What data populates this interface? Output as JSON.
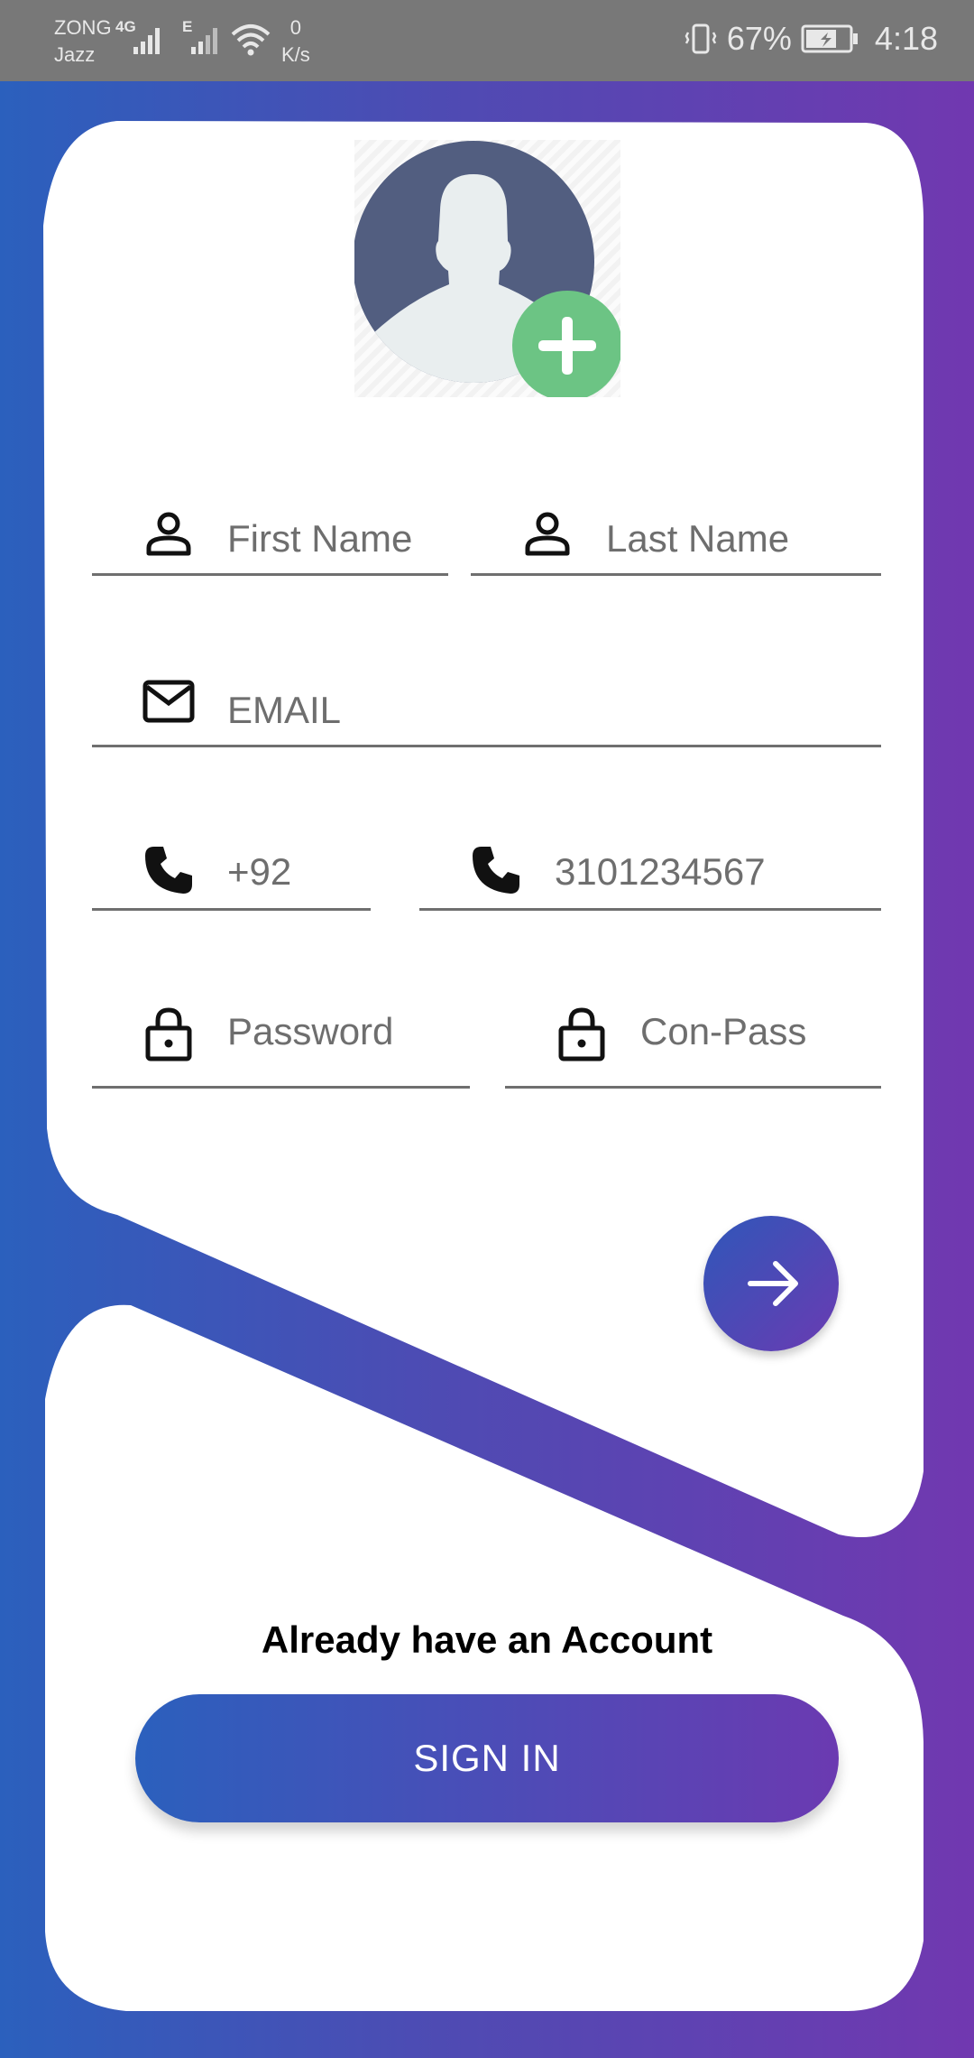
{
  "status_bar": {
    "carrier1": "ZONG",
    "carrier2": "Jazz",
    "net1": "4G",
    "net2": "E",
    "speed_value": "0",
    "speed_unit": "K/s",
    "battery": "67%",
    "time": "4:18"
  },
  "form": {
    "first_name_placeholder": "First Name",
    "last_name_placeholder": "Last Name",
    "email_placeholder": "EMAIL",
    "country_code_value": "+92",
    "phone_value": "3101234567",
    "password_placeholder": "Password",
    "confirm_password_placeholder": "Con-Pass"
  },
  "footer": {
    "already_text": "Already have an Account",
    "signin_label": "SIGN IN"
  },
  "colors": {
    "gradient_start": "#2b60bd",
    "gradient_end": "#7138b0",
    "add_photo_green": "#6cc484"
  },
  "icons": [
    "person-icon",
    "email-icon",
    "phone-icon",
    "lock-icon",
    "arrow-right-icon",
    "plus-icon",
    "avatar-placeholder"
  ]
}
